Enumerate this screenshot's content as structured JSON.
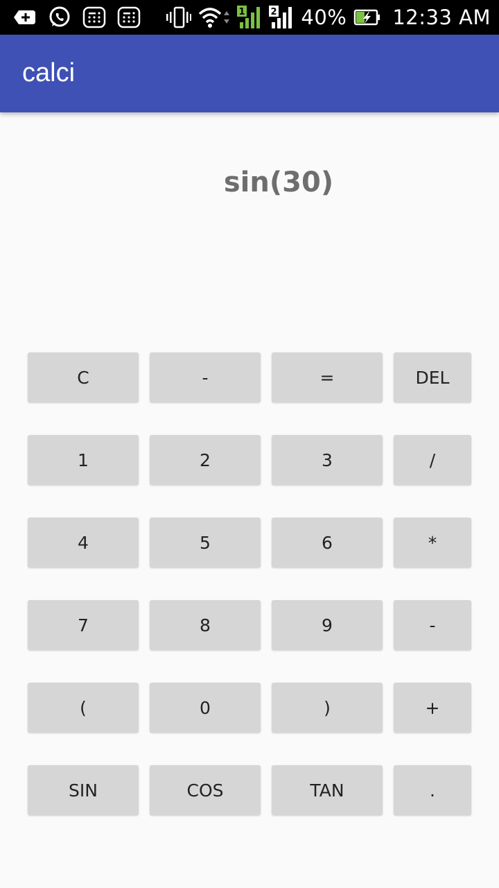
{
  "status_bar": {
    "icons": [
      "add-box-icon",
      "whatsapp-icon",
      "calculator-notify-icon",
      "calculator-notify-icon",
      "vibrate-icon",
      "wifi-icon",
      "sim1-signal-icon",
      "sim2-signal-icon",
      "battery-charging-icon"
    ],
    "sim1_label": "1",
    "sim2_label": "2",
    "battery": "40%",
    "time": "12:33 AM"
  },
  "app_bar": {
    "title": "calci",
    "color": "#3f51b5"
  },
  "display": {
    "expression": "sin(30)"
  },
  "keypad": {
    "rows": [
      [
        "C",
        "-",
        "=",
        "DEL"
      ],
      [
        "1",
        "2",
        "3",
        "/"
      ],
      [
        "4",
        "5",
        "6",
        "*"
      ],
      [
        "7",
        "8",
        "9",
        "-"
      ],
      [
        "(",
        "0",
        ")",
        "+"
      ],
      [
        "SIN",
        "COS",
        "TAN",
        "."
      ]
    ]
  },
  "colors": {
    "button_bg": "#d6d6d6",
    "background": "#fafafa",
    "display_text": "#6e6e6e"
  }
}
